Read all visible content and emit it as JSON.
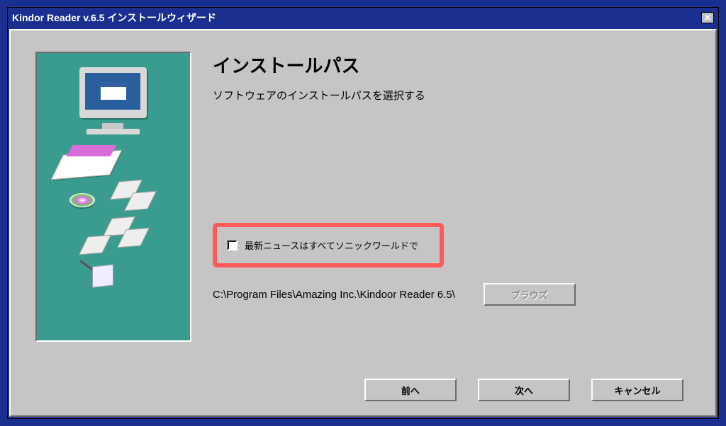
{
  "window": {
    "title": "Kindor Reader v.6.5 インストールウィザード"
  },
  "main": {
    "heading": "インストールパス",
    "subheading": "ソフトウェアのインストールパスを選択する",
    "checkbox_label": "最新ニュースはすべてソニックワールドで",
    "install_path": "C:\\Program Files\\Amazing Inc.\\Kindoor Reader 6.5\\"
  },
  "buttons": {
    "browse": "ブラウズ",
    "back": "前へ",
    "next": "次へ",
    "cancel": "キャンセル"
  }
}
